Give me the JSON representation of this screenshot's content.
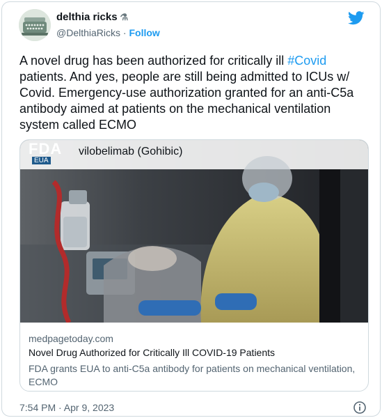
{
  "author": {
    "name": "delthia ricks",
    "name_emoji": "⚗",
    "handle": "@DelthiaRicks",
    "separator": "·",
    "follow_label": "Follow"
  },
  "icons": {
    "avatar": "typewriter-avatar-icon",
    "platform": "twitter-bird-icon",
    "info": "info-icon",
    "brand_color": "#1d9bf0"
  },
  "tweet": {
    "text_before": "A novel drug has been authorized for critically ill ",
    "hashtag": "#Covid",
    "text_after": " patients. And yes, people are still being admitted to ICUs w/ Covid. Emergency-use authorization granted for an anti-C5a antibody aimed at patients on the mechanical ventilation system called ECMO"
  },
  "link_card": {
    "badge_title": "FDA",
    "badge_sub": "EUA",
    "media_caption": "vilobelimab (Gohibic)",
    "domain": "medpagetoday.com",
    "headline": "Novel Drug Authorized for Critically Ill COVID-19 Patients",
    "description": "FDA grants EUA to anti-C5a antibody for patients on mechanical ventilation, ECMO"
  },
  "timestamp": "7:54 PM · Apr 9, 2023"
}
